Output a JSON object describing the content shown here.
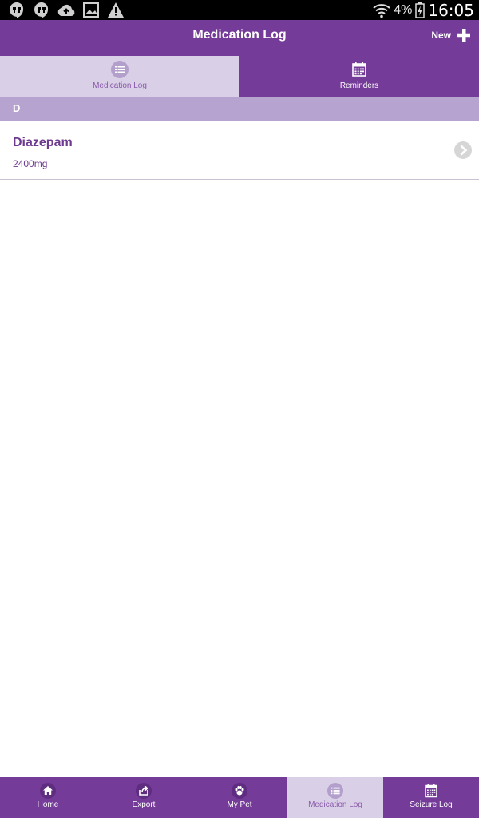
{
  "status_bar": {
    "battery_percent": "4%",
    "time": "16:05"
  },
  "header": {
    "title": "Medication Log",
    "new_label": "New"
  },
  "tabs": [
    {
      "label": "Medication Log",
      "icon": "list-icon",
      "active": true
    },
    {
      "label": "Reminders",
      "icon": "calendar-icon",
      "active": false
    }
  ],
  "section": {
    "letter": "D"
  },
  "medications": [
    {
      "name": "Diazepam",
      "dose": "2400mg"
    }
  ],
  "bottom_nav": [
    {
      "label": "Home",
      "icon": "home-icon",
      "active": false
    },
    {
      "label": "Export",
      "icon": "export-icon",
      "active": false
    },
    {
      "label": "My Pet",
      "icon": "paw-icon",
      "active": false
    },
    {
      "label": "Medication Log",
      "icon": "list-icon",
      "active": true
    },
    {
      "label": "Seizure Log",
      "icon": "calendar-icon",
      "active": false
    }
  ],
  "colors": {
    "primary": "#743b98",
    "active_tab": "#d9cfe6",
    "section_header": "#b6a3cf",
    "text_accent": "#6d3a8f"
  }
}
